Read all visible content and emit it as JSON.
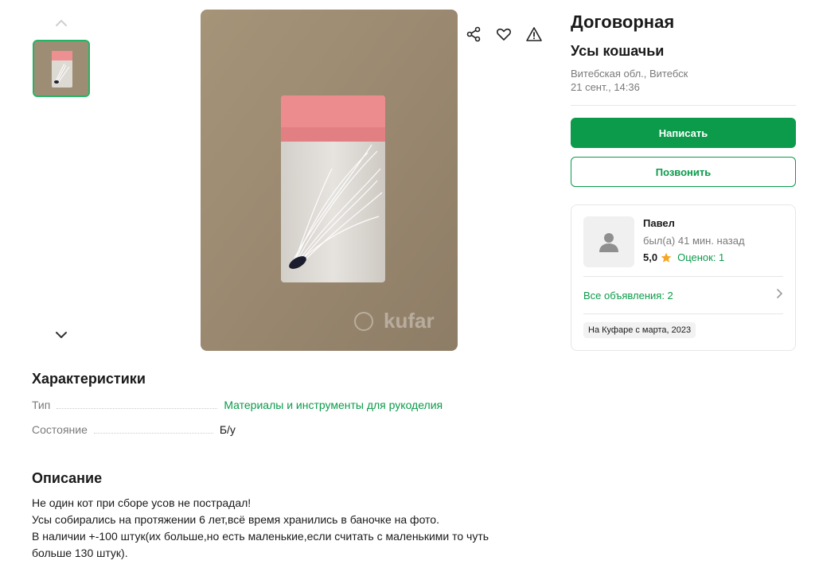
{
  "gallery": {
    "thumb_up_icon": "chevron-up-icon",
    "thumb_down_icon": "chevron-down-icon",
    "watermark": "kufar"
  },
  "actions": {
    "share_icon": "share-icon",
    "favorite_icon": "heart-icon",
    "report_icon": "warning-icon"
  },
  "listing": {
    "price": "Договорная",
    "title": "Усы кошачьи",
    "location": "Витебская обл., Витебск",
    "date": "21 сент., 14:36"
  },
  "buttons": {
    "write": "Написать",
    "call": "Позвонить"
  },
  "seller": {
    "name": "Павел",
    "last_seen": "был(а) 41 мин. назад",
    "rating": "5,0",
    "reviews": "Оценок: 1",
    "all_ads": "Все объявления: 2",
    "since": "На Куфаре с марта, 2023"
  },
  "characteristics": {
    "title": "Характеристики",
    "rows": [
      {
        "label": "Тип",
        "value": "Материалы и инструменты для рукоделия"
      },
      {
        "label": "Состояние",
        "value": "Б/у"
      }
    ]
  },
  "description": {
    "title": "Описание",
    "lines": [
      "Не один кот при сборе усов не пострадал!",
      "Усы собирались на протяжении 6 лет,всё время хранились в баночке на фото.",
      "В наличии +-100 штук(их больше,но есть маленькие,если считать с маленькими то чуть",
      "больше 130 штук)."
    ]
  },
  "colors": {
    "accent": "#0b9b4a",
    "thumb_border": "#25b464",
    "star": "#f5a623"
  }
}
